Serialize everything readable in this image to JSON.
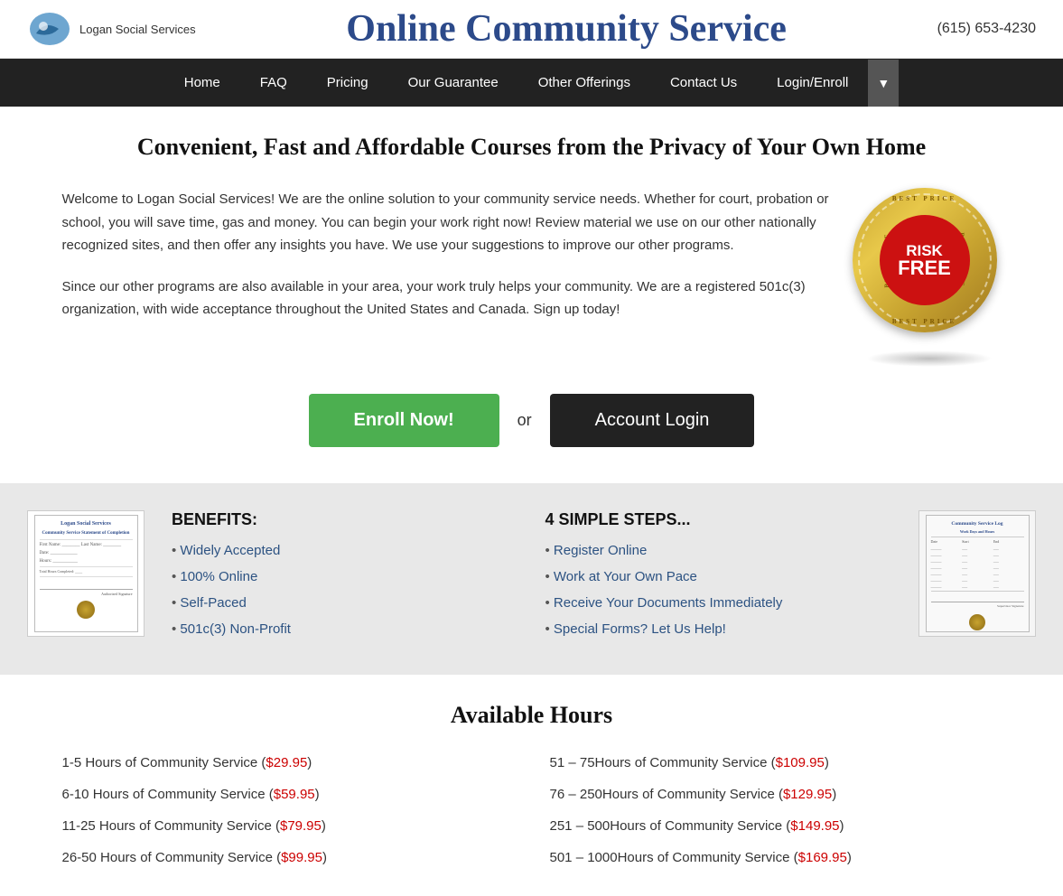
{
  "header": {
    "logo_text": "Logan Social Services",
    "site_title": "Online Community Service",
    "phone": "(615) 653-4230"
  },
  "nav": {
    "items": [
      {
        "label": "Home",
        "href": "#"
      },
      {
        "label": "FAQ",
        "href": "#"
      },
      {
        "label": "Pricing",
        "href": "#"
      },
      {
        "label": "Our Guarantee",
        "href": "#"
      },
      {
        "label": "Other Offerings",
        "href": "#"
      },
      {
        "label": "Contact Us",
        "href": "#"
      },
      {
        "label": "Login/Enroll",
        "href": "#"
      }
    ]
  },
  "main": {
    "headline": "Convenient, Fast and Affordable Courses from the Privacy of Your Own Home",
    "intro_p1": "Welcome to Logan Social Services! We are the online solution to your community service needs. Whether for court, probation or school, you will save time, gas and money. You can begin your work right now! Review material we use on our other nationally recognized sites, and then offer any insights you have. We use your suggestions to improve our other programs.",
    "intro_p2": "Since our other programs are also available in your area, your work truly helps your community. We are a registered 501c(3) organization, with wide acceptance throughout the United States and Canada. Sign up today!",
    "btn_enroll": "Enroll Now!",
    "btn_login": "Account Login",
    "or_text": "or"
  },
  "benefits": {
    "title": "BENEFITS:",
    "items": [
      {
        "label": "Widely Accepted"
      },
      {
        "label": "100% Online"
      },
      {
        "label": "Self-Paced"
      },
      {
        "label": "501c(3) Non-Profit"
      }
    ]
  },
  "steps": {
    "title": "4 SIMPLE STEPS...",
    "items": [
      {
        "label": "Register Online"
      },
      {
        "label": "Work at Your Own Pace"
      },
      {
        "label": "Receive Your Documents Immediately"
      },
      {
        "label": "Special Forms? Let Us Help!"
      }
    ]
  },
  "hours": {
    "title": "Available Hours",
    "rows": [
      {
        "label": "1-5 Hours of Community Service (",
        "price": "$29.95",
        "suffix": ")"
      },
      {
        "label": "6-10 Hours of Community Service (",
        "price": "$59.95",
        "suffix": ")"
      },
      {
        "label": "11-25 Hours of Community Service (",
        "price": "$79.95",
        "suffix": ")"
      },
      {
        "label": "26-50 Hours of Community Service (",
        "price": "$99.95",
        "suffix": ")"
      },
      {
        "label": "51 – 75Hours of Community Service (",
        "price": "$109.95",
        "suffix": ")"
      },
      {
        "label": "76 – 250Hours of Community Service (",
        "price": "$129.95",
        "suffix": ")"
      },
      {
        "label": "251 – 500Hours of Community Service (",
        "price": "$149.95",
        "suffix": ")"
      },
      {
        "label": "501 – 1000Hours of Community Service (",
        "price": "$169.95",
        "suffix": ")"
      }
    ]
  },
  "badge": {
    "risk_text": "RISK",
    "free_text": "FREE",
    "ring_text": "BEST PRICE"
  }
}
